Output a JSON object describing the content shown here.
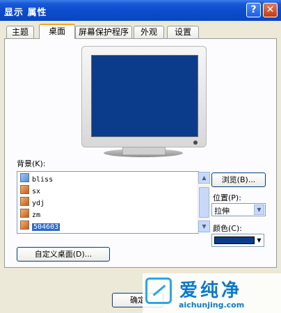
{
  "window": {
    "title": "显示 属性",
    "help_label": "?",
    "close_label": "✕"
  },
  "tabs": [
    {
      "label": "主题",
      "active": false
    },
    {
      "label": "桌面",
      "active": true
    },
    {
      "label": "屏幕保护程序",
      "active": false
    },
    {
      "label": "外观",
      "active": false
    },
    {
      "label": "设置",
      "active": false
    }
  ],
  "desktop": {
    "background_label": "背景(K):",
    "background_items": [
      {
        "name": "bliss",
        "icon": "image-file-icon",
        "selected": false
      },
      {
        "name": "sx",
        "icon": "image-file-icon",
        "selected": false
      },
      {
        "name": "ydj",
        "icon": "image-file-icon",
        "selected": false
      },
      {
        "name": "zm",
        "icon": "image-file-icon",
        "selected": false
      },
      {
        "name": "504603",
        "icon": "image-file-icon",
        "selected": true
      }
    ],
    "browse_button": "浏览(B)...",
    "position_label": "位置(P):",
    "position_value": "拉伸",
    "color_label": "颜色(C):",
    "color_value": "#0b3c8c",
    "customize_button": "自定义桌面(D)...",
    "ok_button": "确定"
  },
  "watermark": {
    "brand_cn": "爱纯净",
    "url": "aichunjing.com"
  }
}
